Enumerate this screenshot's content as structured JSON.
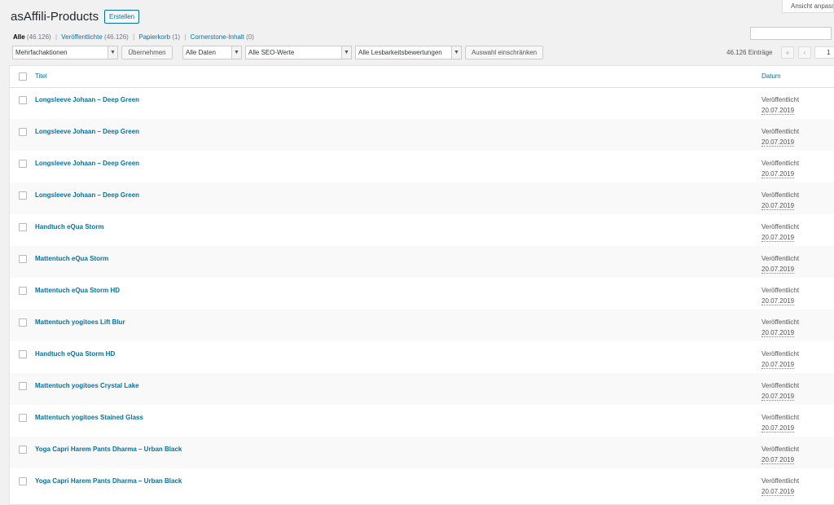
{
  "screen_options": "Ansicht anpassen",
  "page": {
    "title": "asAffili-Products",
    "add_button": "Erstellen"
  },
  "views": [
    {
      "label": "Alle",
      "count": "(46.126)"
    },
    {
      "label": "Veröffentlichte",
      "count": "(46.126)"
    },
    {
      "label": "Papierkorb",
      "count": "(1)"
    },
    {
      "label": "Cornerstone-Inhalt",
      "count": "(0)"
    }
  ],
  "filters": {
    "bulk_actions": "Mehrfachaktionen",
    "apply": "Übernehmen",
    "dates": "Alle Daten",
    "seo": "Alle SEO-Werte",
    "readability": "Alle Lesbarkeitsbewertungen",
    "filter_button": "Auswahl einschränken"
  },
  "pagination": {
    "total": "46.126 Einträge",
    "first": "«",
    "prev": "‹",
    "current_page": "1"
  },
  "table": {
    "col_title": "Titel",
    "col_date": "Datum",
    "rows": [
      {
        "title": "Longsleeve Johaan – Deep Green",
        "status": "Veröffentlicht",
        "date": "20.07.2019"
      },
      {
        "title": "Longsleeve Johaan – Deep Green",
        "status": "Veröffentlicht",
        "date": "20.07.2019"
      },
      {
        "title": "Longsleeve Johaan – Deep Green",
        "status": "Veröffentlicht",
        "date": "20.07.2019"
      },
      {
        "title": "Longsleeve Johaan – Deep Green",
        "status": "Veröffentlicht",
        "date": "20.07.2019"
      },
      {
        "title": "Handtuch eQua Storm",
        "status": "Veröffentlicht",
        "date": "20.07.2019"
      },
      {
        "title": "Mattentuch eQua Storm",
        "status": "Veröffentlicht",
        "date": "20.07.2019"
      },
      {
        "title": "Mattentuch eQua Storm HD",
        "status": "Veröffentlicht",
        "date": "20.07.2019"
      },
      {
        "title": "Mattentuch yogitoes Lift Blur",
        "status": "Veröffentlicht",
        "date": "20.07.2019"
      },
      {
        "title": "Handtuch eQua Storm HD",
        "status": "Veröffentlicht",
        "date": "20.07.2019"
      },
      {
        "title": "Mattentuch yogitoes Crystal Lake",
        "status": "Veröffentlicht",
        "date": "20.07.2019"
      },
      {
        "title": "Mattentuch yogitoes Stained Glass",
        "status": "Veröffentlicht",
        "date": "20.07.2019"
      },
      {
        "title": "Yoga Capri Harem Pants Dharma – Urban Black",
        "status": "Veröffentlicht",
        "date": "20.07.2019"
      },
      {
        "title": "Yoga Capri Harem Pants Dharma – Urban Black",
        "status": "Veröffentlicht",
        "date": "20.07.2019"
      }
    ]
  }
}
